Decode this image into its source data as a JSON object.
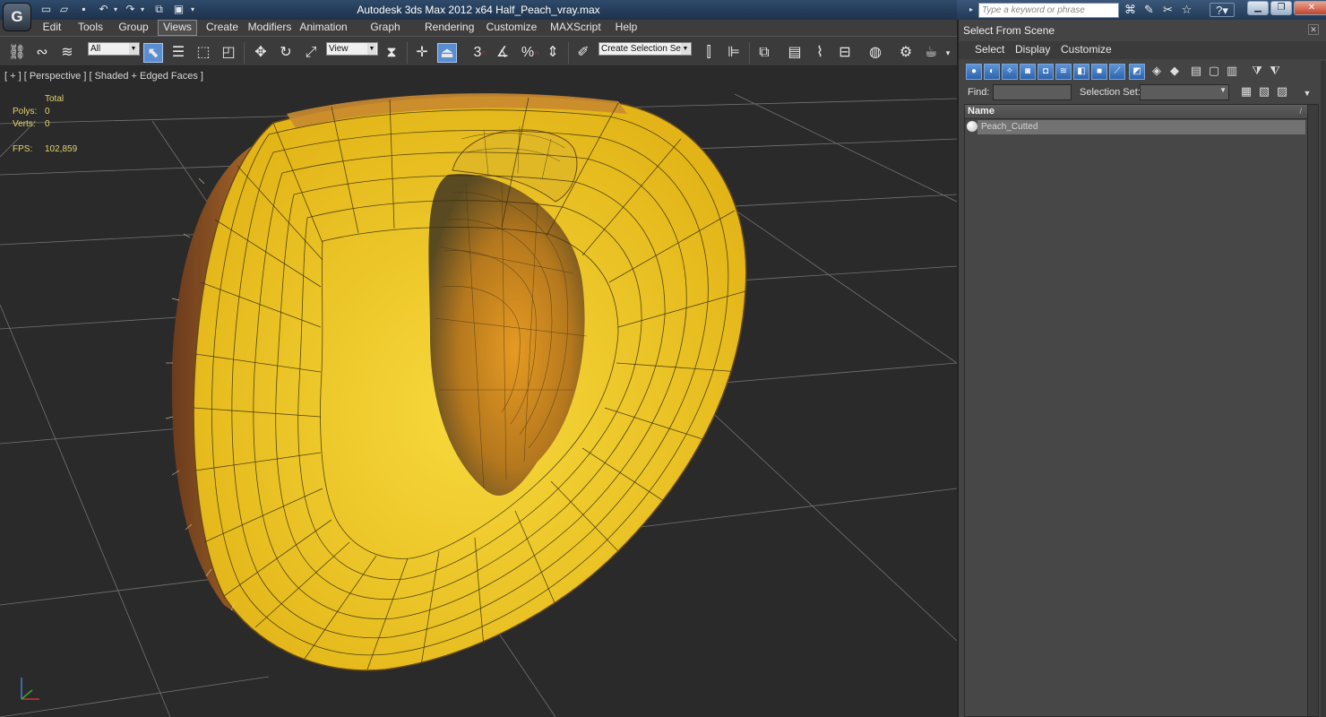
{
  "window": {
    "title": "Autodesk 3ds Max  2012 x64      Half_Peach_vray.max",
    "logo": "G",
    "search_placeholder": "Type a keyword or phrase",
    "window_controls": [
      "minimize-icon",
      "restore-icon",
      "close-icon"
    ]
  },
  "menu": {
    "items": [
      "Edit",
      "Tools",
      "Group",
      "Views",
      "Create",
      "Modifiers",
      "Animation",
      "Graph Editors",
      "Rendering",
      "Customize",
      "MAXScript",
      "Help"
    ],
    "active": "Views"
  },
  "toolbar": {
    "selection_filter": "All",
    "reference_coord": "View",
    "named_selection_placeholder": "Create Selection Se",
    "snap_labels": [
      "3",
      "%",
      "n"
    ]
  },
  "viewport": {
    "label": "[ + ] [ Perspective ] [ Shaded + Edged Faces ]",
    "stats": {
      "header": "Total",
      "polys_label": "Polys:",
      "polys_value": "0",
      "verts_label": "Verts:",
      "verts_value": "0",
      "fps_label": "FPS:",
      "fps_value": "102,859"
    },
    "colors": {
      "background": "#2a2a2a",
      "flesh": "#f0c81e",
      "skin": "#b86a2c",
      "pit": "#c98420",
      "wire": "#2f2a10",
      "grid": "#8b8b8b"
    }
  },
  "scene_panel": {
    "title": "Select From Scene",
    "menu": [
      "Select",
      "Display",
      "Customize"
    ],
    "find_label": "Find:",
    "find_value": "",
    "selection_set_label": "Selection Set:",
    "selection_set_value": "",
    "column_name": "Name",
    "sort_indicator": "/",
    "objects": [
      "Peach_Cutted"
    ]
  }
}
